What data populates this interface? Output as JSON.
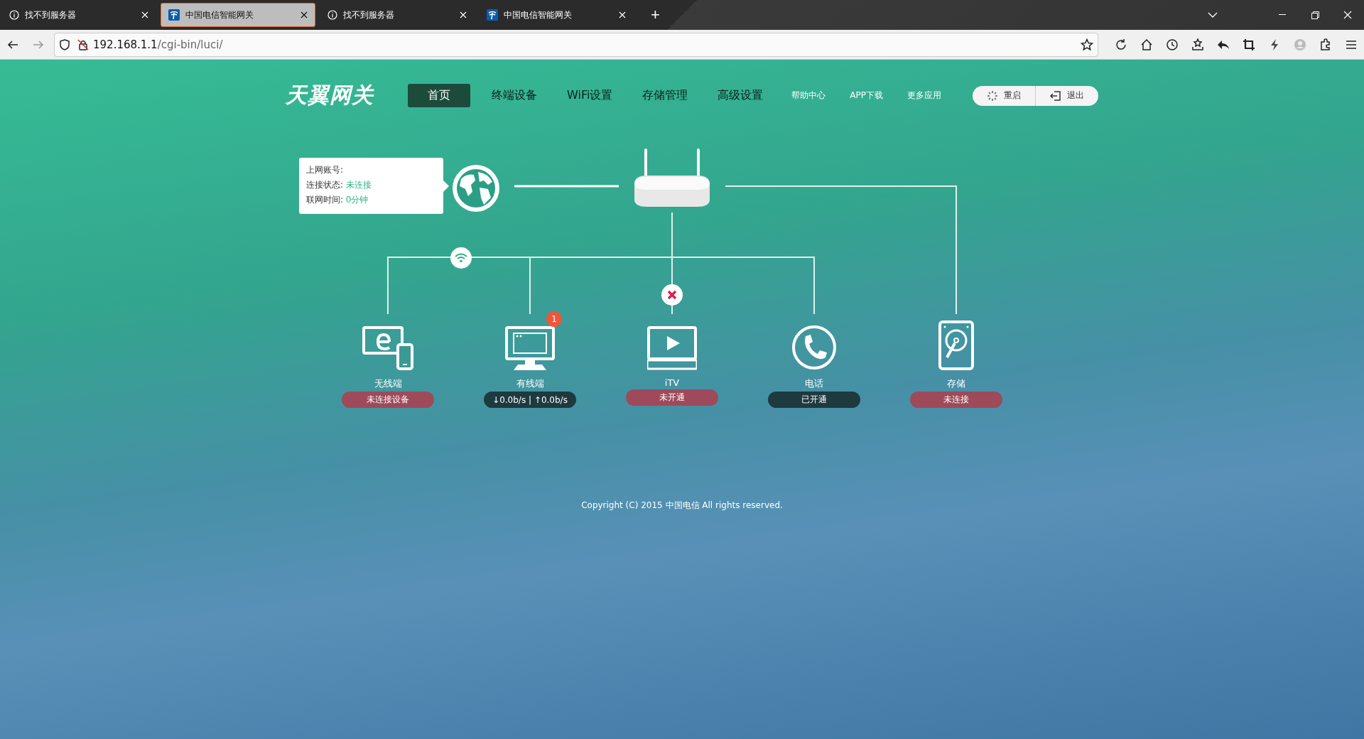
{
  "browser": {
    "tabs": [
      {
        "title": "找不到服务器",
        "kind": "error",
        "selected": false
      },
      {
        "title": "中国电信智能网关",
        "kind": "telecom",
        "selected": true
      },
      {
        "title": "找不到服务器",
        "kind": "error",
        "selected": false
      },
      {
        "title": "中国电信智能网关",
        "kind": "telecom",
        "selected": false
      }
    ],
    "new_tab": "+",
    "address": {
      "host": "192.168.1.1",
      "path": "/cgi-bin/luci/"
    }
  },
  "header": {
    "logo": "天翼网关",
    "nav": [
      {
        "label": "首页",
        "selected": true
      },
      {
        "label": "终端设备",
        "selected": false
      },
      {
        "label": "WiFi设置",
        "selected": false
      },
      {
        "label": "存储管理",
        "selected": false
      },
      {
        "label": "高级设置",
        "selected": false
      }
    ],
    "links": [
      "帮助中心",
      "APP下载",
      "更多应用"
    ],
    "actions": [
      {
        "label": "重启",
        "kind": "restart"
      },
      {
        "label": "退出",
        "kind": "logout"
      }
    ]
  },
  "internet": {
    "fields": [
      {
        "label": "上网账号:"
      },
      {
        "label": "连接状态:",
        "value": "未连接"
      },
      {
        "label": "联网时间:",
        "value": "0分钟"
      }
    ]
  },
  "devices": [
    {
      "kind": "wireless",
      "label": "无线端",
      "status": "未连接设备",
      "ok": false,
      "wifi": true
    },
    {
      "kind": "wired",
      "label": "有线端",
      "status": "↓0.0b/s | ↑0.0b/s",
      "ok": true,
      "badge": "1"
    },
    {
      "kind": "itv",
      "label": "iTV",
      "status": "未开通",
      "ok": false,
      "link_error": true
    },
    {
      "kind": "phone",
      "label": "电话",
      "status": "已开通",
      "ok": true
    },
    {
      "kind": "storage",
      "label": "存储",
      "status": "未连接",
      "ok": false
    }
  ],
  "footer": "Copyright (C) 2015 中国电信 All rights reserved."
}
